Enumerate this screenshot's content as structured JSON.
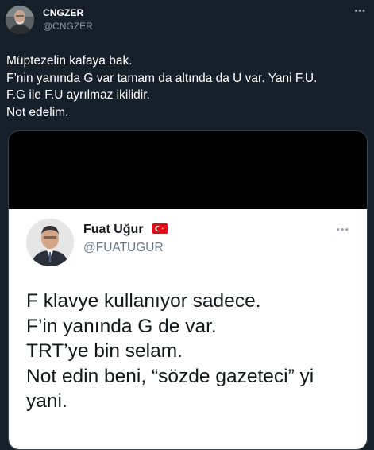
{
  "tweet": {
    "author_name": "CNGZER",
    "author_handle": "@CNGZER",
    "more_label": "•••",
    "text_lines": [
      "Müptezelin kafaya bak.",
      "F’nin yanında G var tamam da altında da U var. Yani F.U.",
      "F.G ile F.U ayrılmaz ikilidir.",
      "Not edelim."
    ]
  },
  "embedded_screenshot": {
    "author_name": "Fuat Uğur",
    "flag_icon": "turkey-flag-icon",
    "author_handle": "@FUATUGUR",
    "more_label": "•••",
    "text_lines": [
      "F klavye kullanıyor sadece.",
      "F’in yanında G de var.",
      "TRT’ye bin selam.",
      "Not edin beni, “sözde gazeteci” yi",
      "yani."
    ]
  },
  "colors": {
    "background": "#15202b",
    "secondary_text": "#8899a6",
    "card_border": "#38444d",
    "flag_red": "#e30a17"
  }
}
